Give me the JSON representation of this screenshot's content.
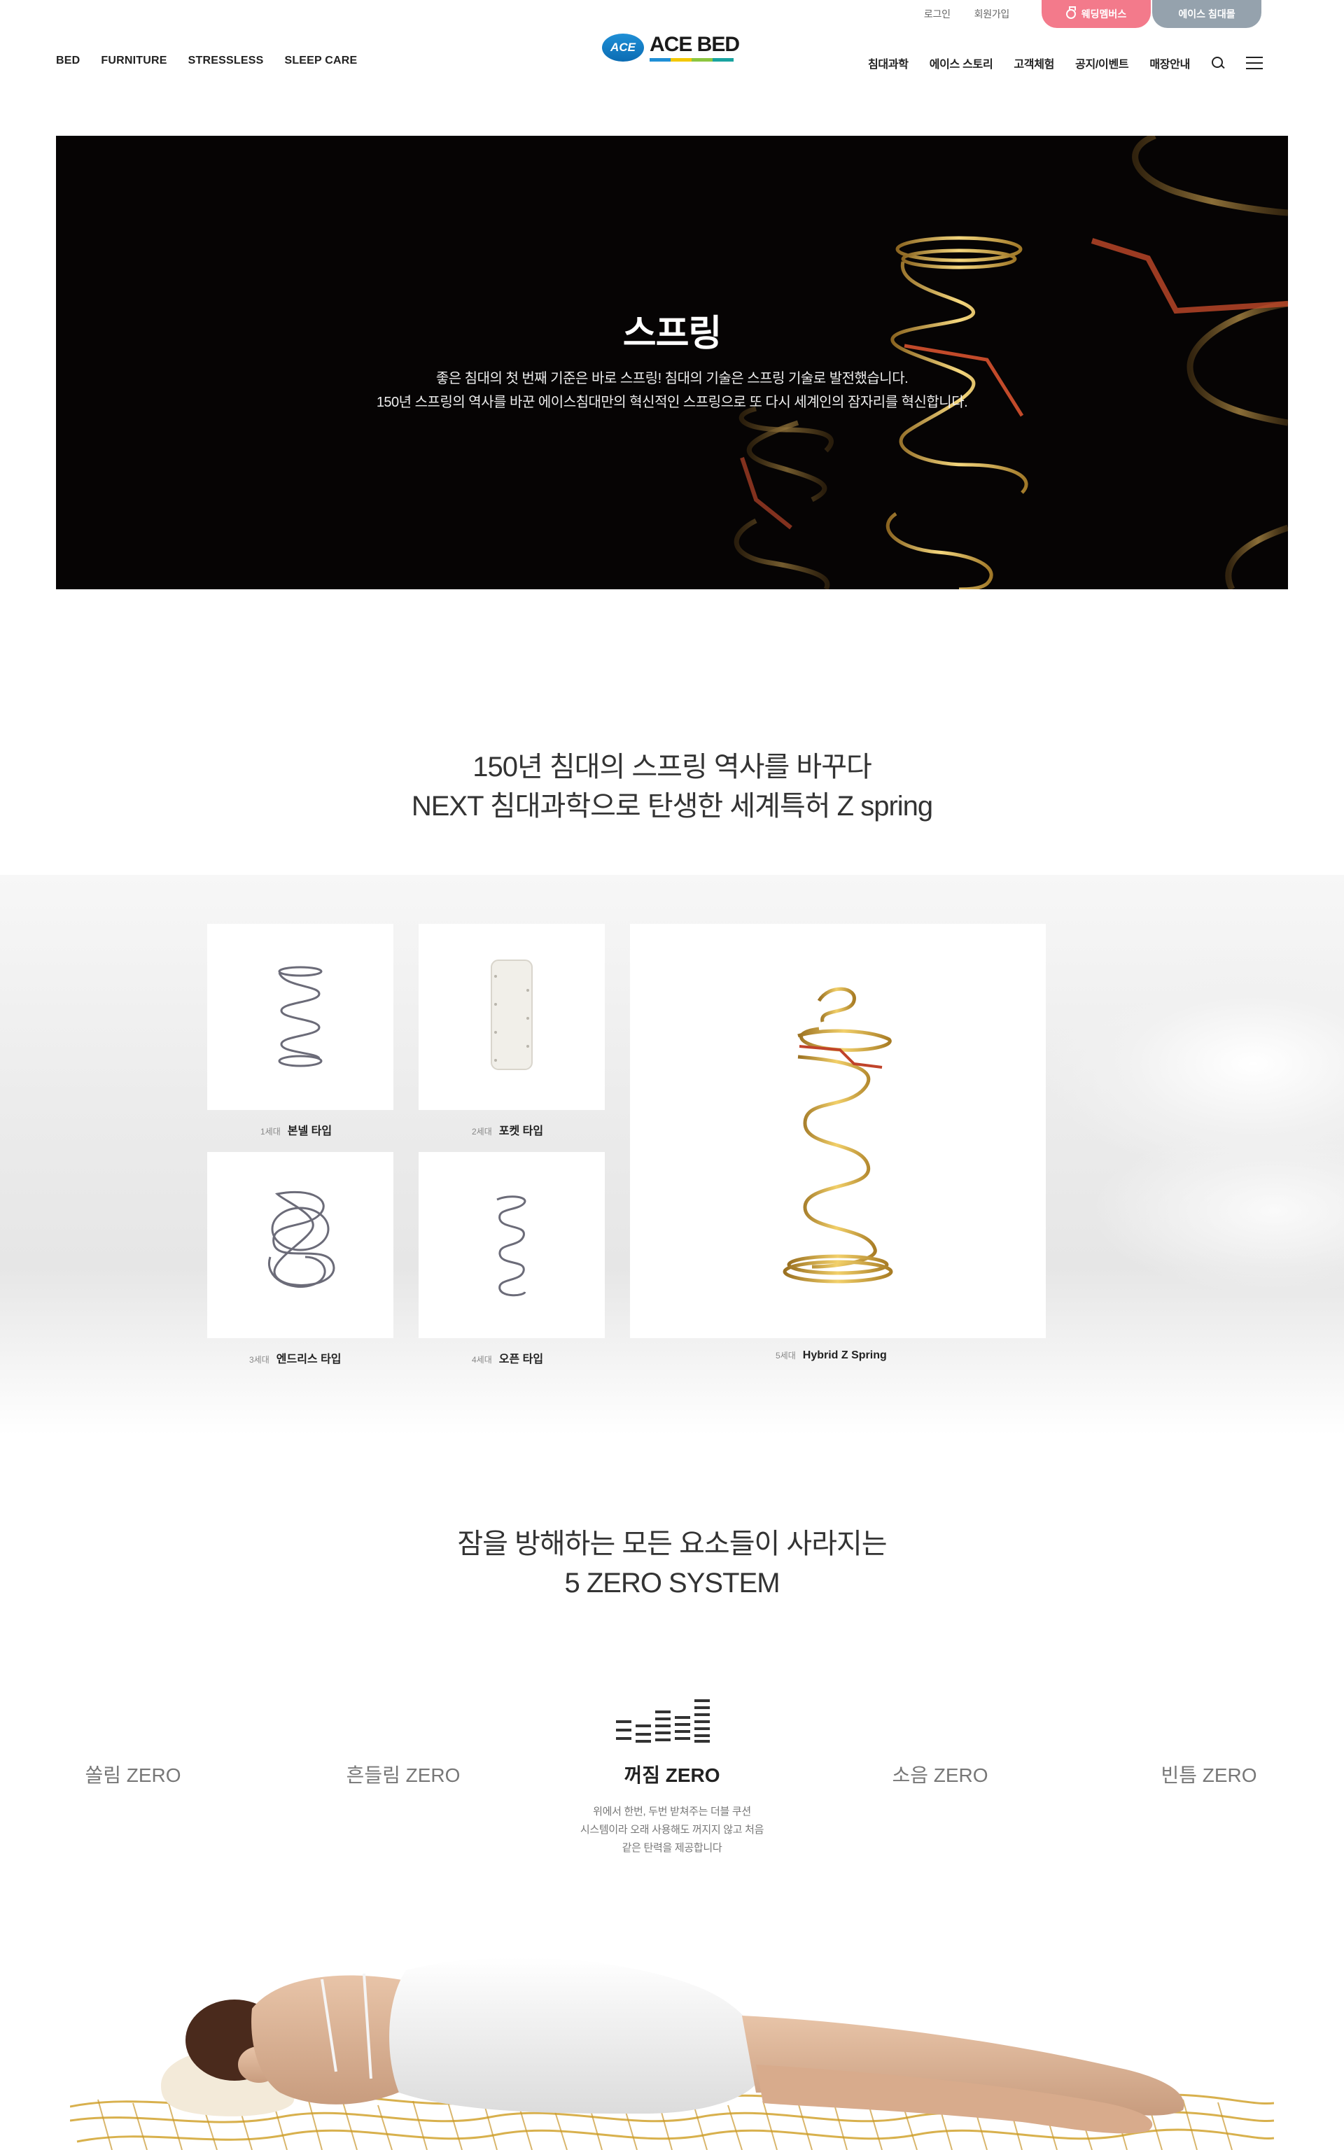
{
  "header": {
    "utility": {
      "login": "로그인",
      "signup": "회원가입",
      "wedding_button": "웨딩멤버스",
      "mall_button": "에이스 침대몰"
    },
    "logo": {
      "badge": "ACE",
      "text": "ACE BED"
    },
    "nav_left": [
      "BED",
      "FURNITURE",
      "STRESSLESS",
      "SLEEP CARE"
    ],
    "nav_right": [
      "침대과학",
      "에이스 스토리",
      "고객체험",
      "공지/이벤트",
      "매장안내"
    ]
  },
  "hero": {
    "title": "스프링",
    "desc_line1": "좋은 침대의 첫 번째 기준은 바로 스프링! 침대의 기술은 스프링 기술로 발전했습니다.",
    "desc_line2": "150년 스프링의 역사를 바꾼 에이스침대만의 혁신적인 스프링으로 또 다시 세계인의 잠자리를 혁신합니다."
  },
  "section1": {
    "heading_line1": "150년 침대의 스프링 역사를 바꾸다",
    "heading_line2": "NEXT 침대과학으로 탄생한 세계특허 Z spring",
    "springs": [
      {
        "gen": "1세대",
        "name": "본넬 타입"
      },
      {
        "gen": "2세대",
        "name": "포켓 타입"
      },
      {
        "gen": "3세대",
        "name": "엔드리스 타입"
      },
      {
        "gen": "4세대",
        "name": "오픈 타입"
      },
      {
        "gen": "5세대",
        "name": "Hybrid Z Spring"
      }
    ]
  },
  "section2": {
    "heading_line1": "잠을 방해하는 모든 요소들이 사라지는",
    "heading_line2": "5 ZERO SYSTEM",
    "zeros": [
      "쏠림 ZERO",
      "흔들림 ZERO",
      "꺼짐 ZERO",
      "소음 ZERO",
      "빈틈 ZERO"
    ],
    "active_index": 2,
    "desc_line1": "위에서 한번, 두번 받쳐주는 더블 쿠션",
    "desc_line2": "시스템이라 오래 사용해도 꺼지지 않고 처음",
    "desc_line3": "같은 탄력을 제공합니다"
  },
  "colors": {
    "wedding": "#f37a8b",
    "mall": "#95a2ad",
    "hero_bg": "#060404",
    "gold": "#d8a93b",
    "logo_blue": "#1f8fd6"
  },
  "icons": [
    "ring-icon",
    "search-icon",
    "menu-icon",
    "equalizer-icon"
  ]
}
